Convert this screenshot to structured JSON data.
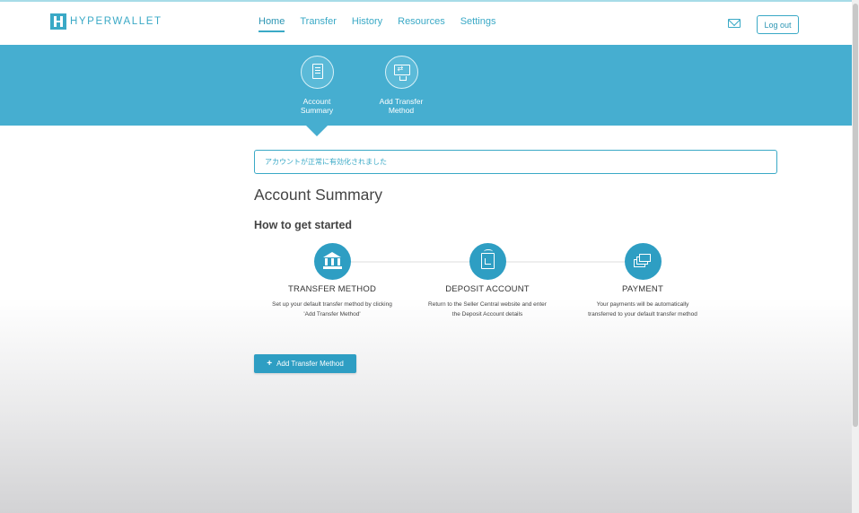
{
  "brand": {
    "name": "HYPERWALLET",
    "color": "#3aa9c6"
  },
  "nav": {
    "items": [
      {
        "label": "Home",
        "active": true
      },
      {
        "label": "Transfer",
        "active": false
      },
      {
        "label": "History",
        "active": false
      },
      {
        "label": "Resources",
        "active": false
      },
      {
        "label": "Settings",
        "active": false
      }
    ]
  },
  "header": {
    "mail_icon": "envelope-icon",
    "logout_label": "Log out"
  },
  "steps": [
    {
      "label_line1": "Account",
      "label_line2": "Summary",
      "icon": "document-icon",
      "active": true
    },
    {
      "label_line1": "Add Transfer",
      "label_line2": "Method",
      "icon": "monitor-transfer-icon",
      "active": false
    }
  ],
  "alert": {
    "message": "アカウントが正常に有効化されました"
  },
  "main": {
    "title": "Account Summary",
    "subtitle": "How to get started",
    "features": [
      {
        "icon": "bank-icon",
        "title": "TRANSFER METHOD",
        "desc_line1": "Set up your default transfer method by clicking",
        "desc_line2": "'Add Transfer Method'"
      },
      {
        "icon": "deposit-icon",
        "title": "DEPOSIT ACCOUNT",
        "desc_line1": "Return to the Seller Central website and enter",
        "desc_line2": "the Deposit Account details"
      },
      {
        "icon": "payment-icon",
        "title": "PAYMENT",
        "desc_line1": "Your payments will be automatically",
        "desc_line2": "transferred to your default transfer method"
      }
    ],
    "add_button_label": "Add Transfer Method"
  },
  "colors": {
    "accent": "#46aed0",
    "button": "#2e9ec3"
  }
}
